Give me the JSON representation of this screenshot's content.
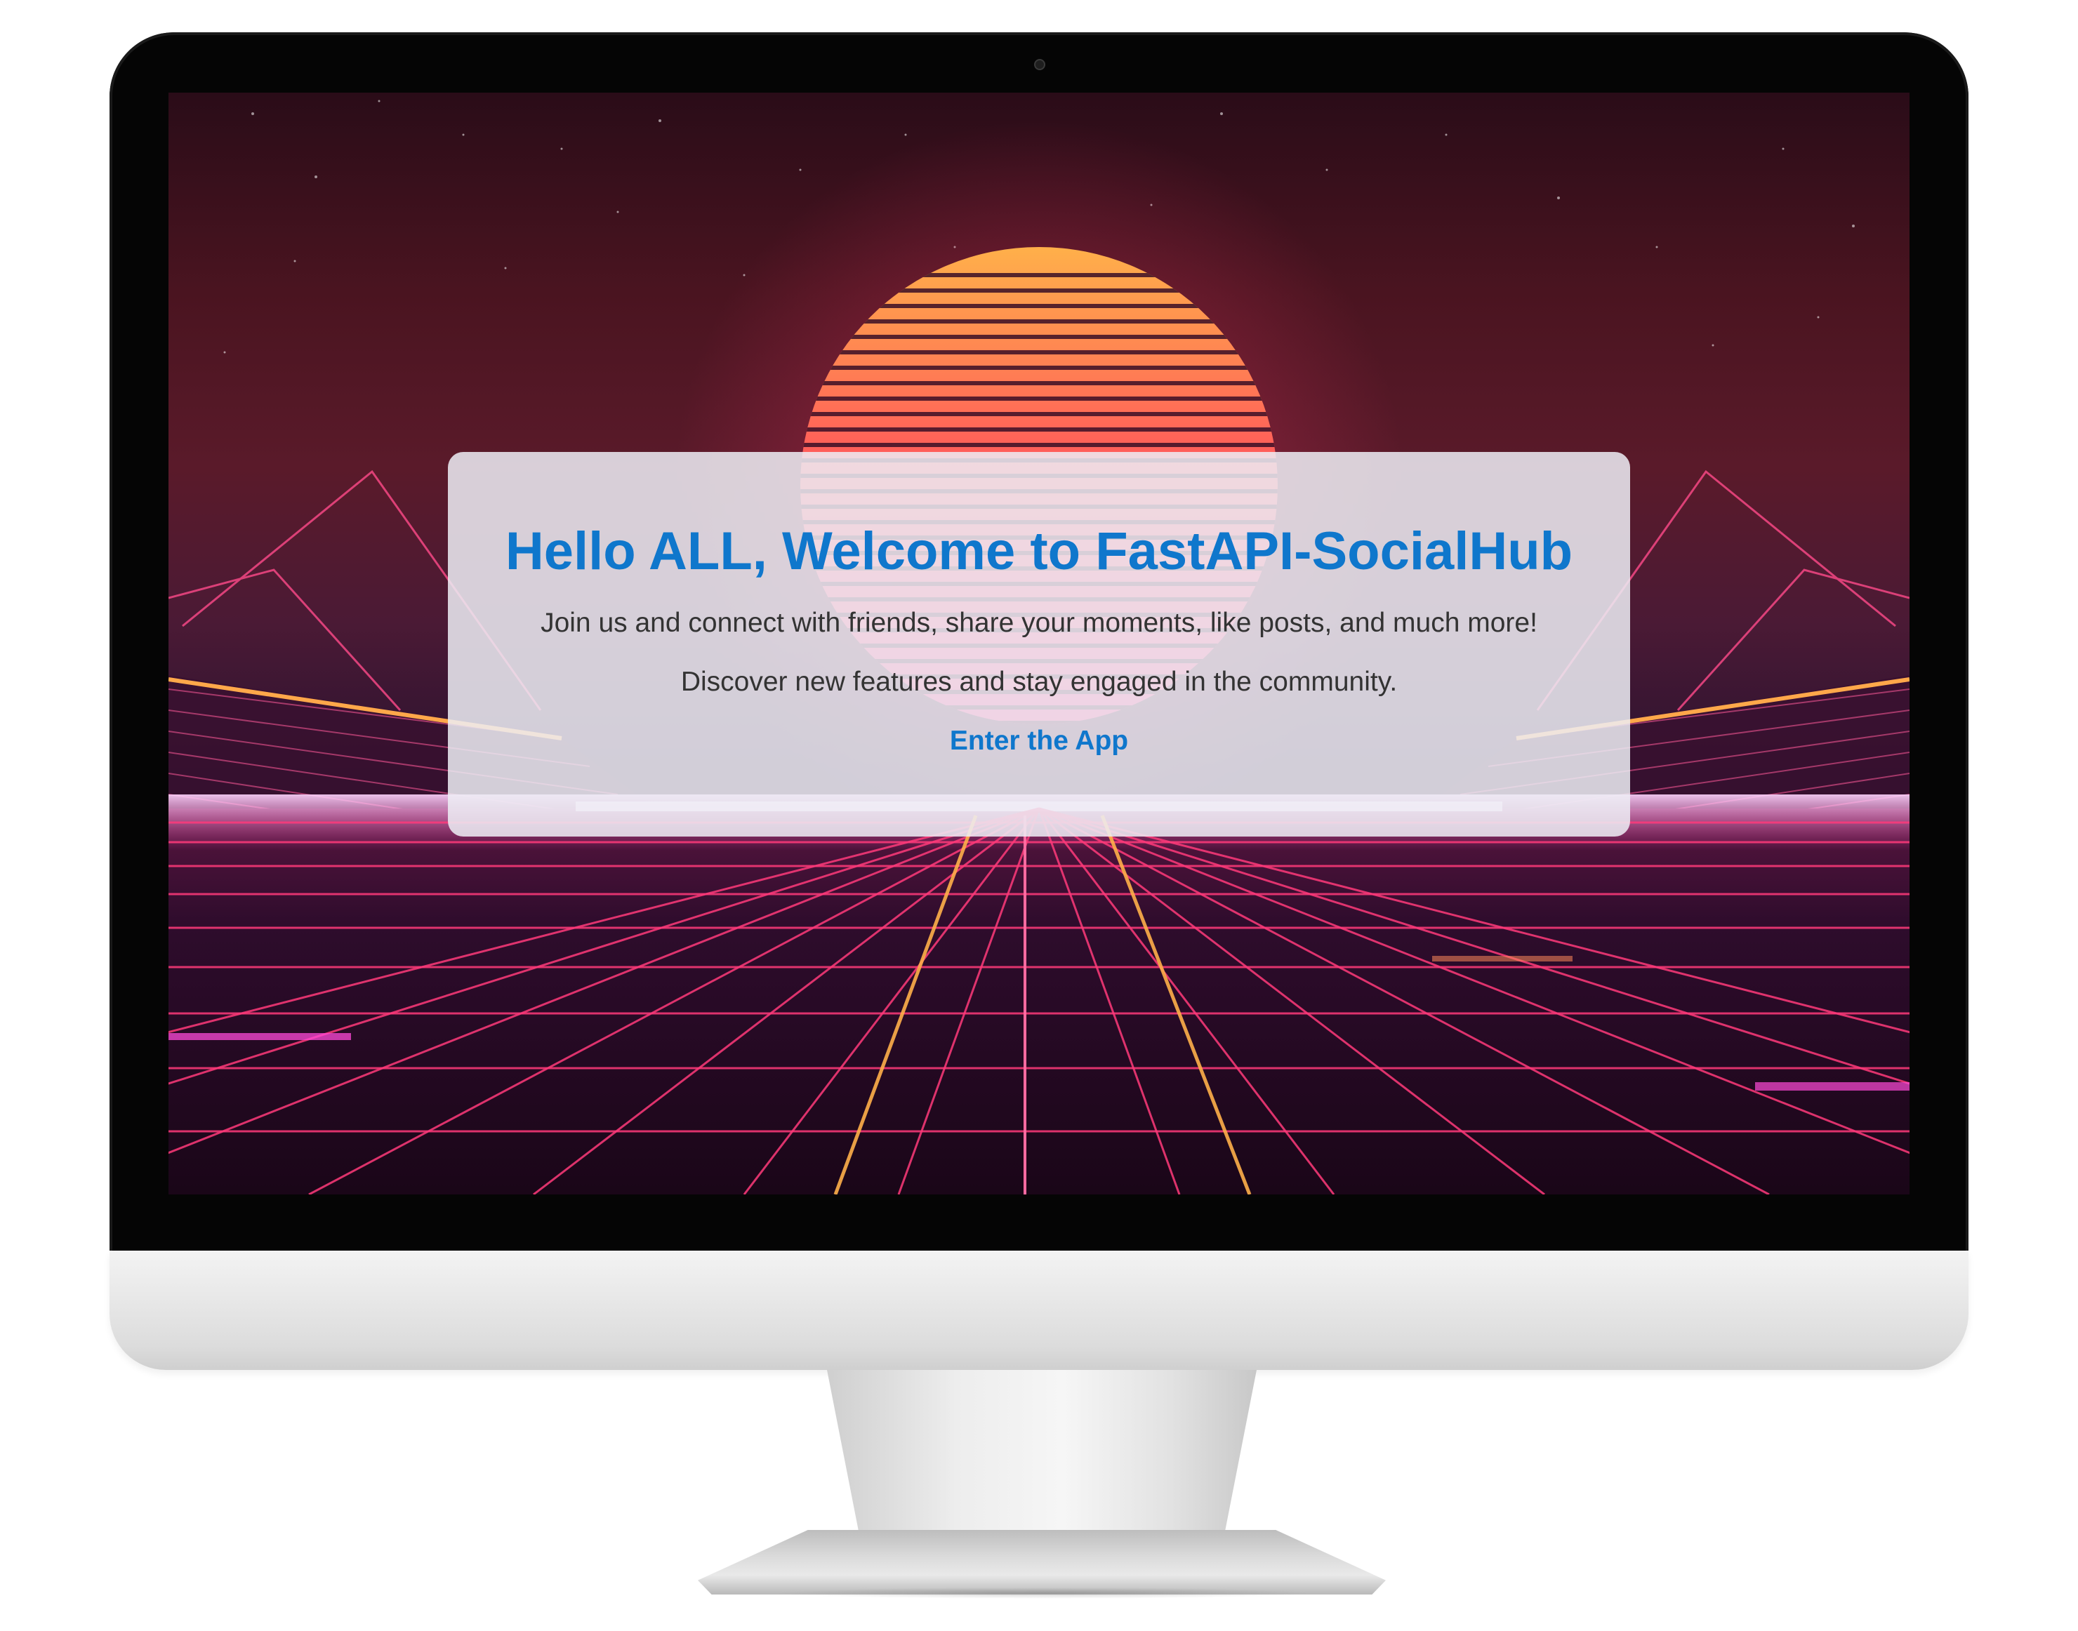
{
  "welcome": {
    "title": "Hello ALL, Welcome to FastAPI-SocialHub",
    "line1": "Join us and connect with friends, share your moments, like posts, and much more!",
    "line2": "Discover new features and stay engaged in the community.",
    "enter_link": "Enter the App"
  },
  "colors": {
    "accent": "#0f77cc",
    "body_text": "#333333",
    "card_background": "#eeeef4",
    "bezel": "#050505"
  },
  "icons": {
    "camera": "camera-dot-icon"
  }
}
